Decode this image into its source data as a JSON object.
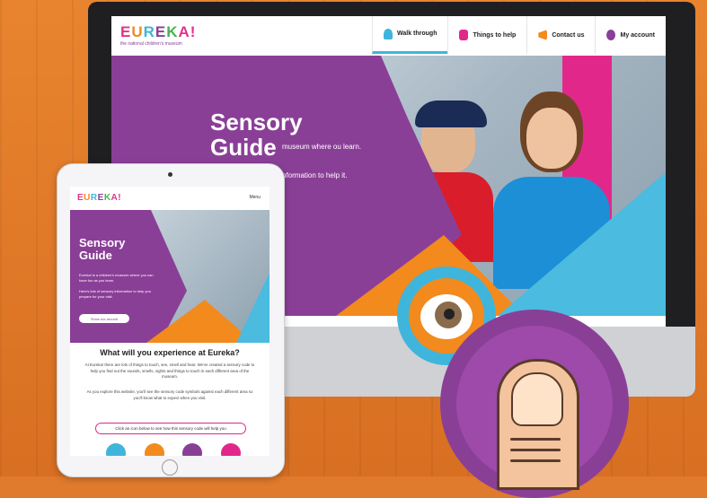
{
  "desktop": {
    "logo": "EUREKA!",
    "logo_tagline": "the national children's museum",
    "nav": [
      {
        "label": "Walk through",
        "icon": "walk-icon",
        "color": "#3fb5dc"
      },
      {
        "label": "Things to help",
        "icon": "hand-icon",
        "color": "#e1288a"
      },
      {
        "label": "Contact us",
        "icon": "megaphone-icon",
        "color": "#f28a1d"
      },
      {
        "label": "My account",
        "icon": "account-icon",
        "color": "#8a3f97"
      }
    ],
    "hero_title_1": "Sensory",
    "hero_title_2": "Guide",
    "hero_p1": "museum where ou learn.",
    "hero_p2": "nformation to help it.",
    "hero_button": ""
  },
  "tablet": {
    "logo": "EUREKA!",
    "menu": "Menu",
    "hero_title_1": "Sensory",
    "hero_title_2": "Guide",
    "hero_p1": "Eureka! is a children's museum where you can have fun as you learn.",
    "hero_p2": "Here's lots of sensory information to help you prepare for your visit.",
    "hero_button": "Show me around",
    "section_title": "What will you experience at Eureka?",
    "body_1": "At Eureka! there are lots of things to touch, see, smell and hear. We've created a sensory code to help you find out the sounds, smells, sights and things to touch in each different area of the museum.",
    "body_2": "As you explore this website, you'll see the sensory code symbols against each different area so you'll know what to expect when you visit.",
    "search_prompt": "Click an icon below to see how this sensory code will help you"
  },
  "colors": {
    "purple": "#8a3f97",
    "orange": "#f28a1d",
    "blue": "#4bbbe0",
    "pink": "#e1288a",
    "background": "#e07a2c"
  }
}
